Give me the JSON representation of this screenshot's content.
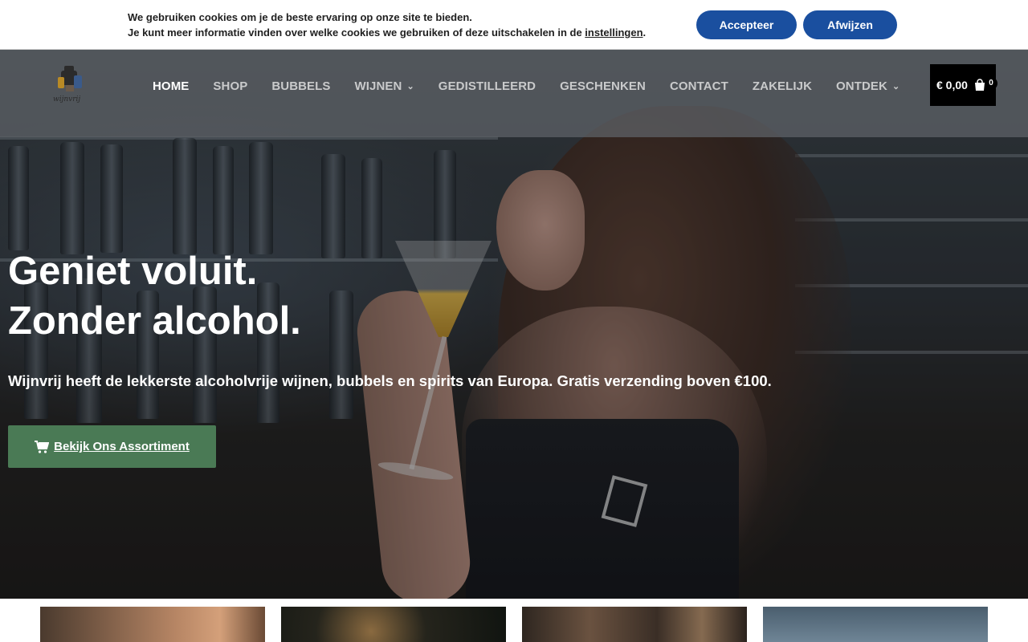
{
  "cookie": {
    "line1": "We gebruiken cookies om je de beste ervaring op onze site te bieden.",
    "line2_prefix": "Je kunt meer informatie vinden over welke cookies we gebruiken of deze uitschakelen in de ",
    "line2_link": "instellingen",
    "line2_suffix": ".",
    "accept_label": "Accepteer",
    "reject_label": "Afwijzen"
  },
  "header": {
    "logo_icon": "wijnvrij-logo",
    "nav": [
      {
        "label": "HOME",
        "active": true,
        "dropdown": false
      },
      {
        "label": "SHOP",
        "active": false,
        "dropdown": false
      },
      {
        "label": "BUBBELS",
        "active": false,
        "dropdown": false
      },
      {
        "label": "WIJNEN",
        "active": false,
        "dropdown": true
      },
      {
        "label": "GEDISTILLEERD",
        "active": false,
        "dropdown": false
      },
      {
        "label": "GESCHENKEN",
        "active": false,
        "dropdown": false
      },
      {
        "label": "CONTACT",
        "active": false,
        "dropdown": false
      },
      {
        "label": "ZAKELIJK",
        "active": false,
        "dropdown": false
      },
      {
        "label": "ONTDEK",
        "active": false,
        "dropdown": true
      }
    ],
    "cart_total": "€ 0,00",
    "cart_count": "0",
    "cart_icon": "shopping-bag-icon"
  },
  "hero": {
    "title_line1": "Geniet voluit.",
    "title_line2": "Zonder alcohol.",
    "subtitle": "Wijnvrij heeft de lekkerste alcoholvrije wijnen, bubbels en spirits van Europa. Gratis verzending boven €100.",
    "cta_label": "Bekijk Ons Assortiment",
    "cta_icon": "shopping-cart-icon"
  },
  "colors": {
    "cookie_button": "#1a4f9f",
    "cta_button": "#4a7a55",
    "cart_background": "#000000"
  }
}
